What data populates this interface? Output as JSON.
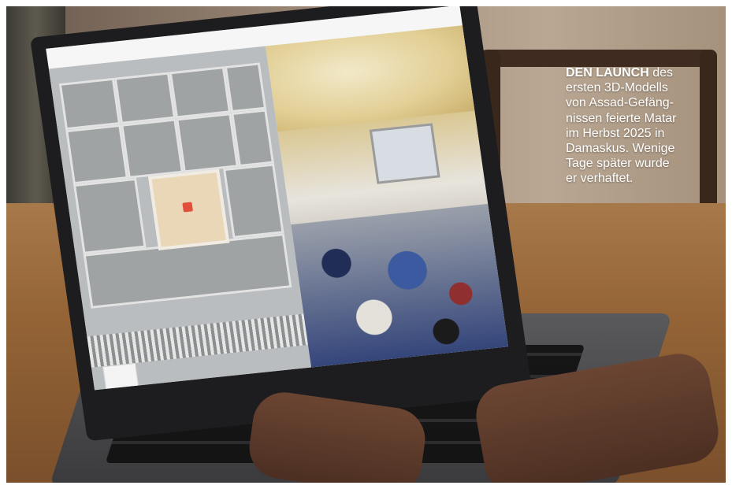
{
  "caption": {
    "lead": "DEN LAUNCH",
    "lines": [
      " des",
      "ersten 3D-Modells",
      "von Assad-Gefäng-",
      "nissen feierte Matar",
      "im Herbst 2025 in",
      "Damaskus. Wenige",
      "Tage später wurde",
      "er verhaftet."
    ]
  },
  "colors": {
    "caption_text": "#ffffff",
    "highlight_marker": "#e2503c"
  }
}
